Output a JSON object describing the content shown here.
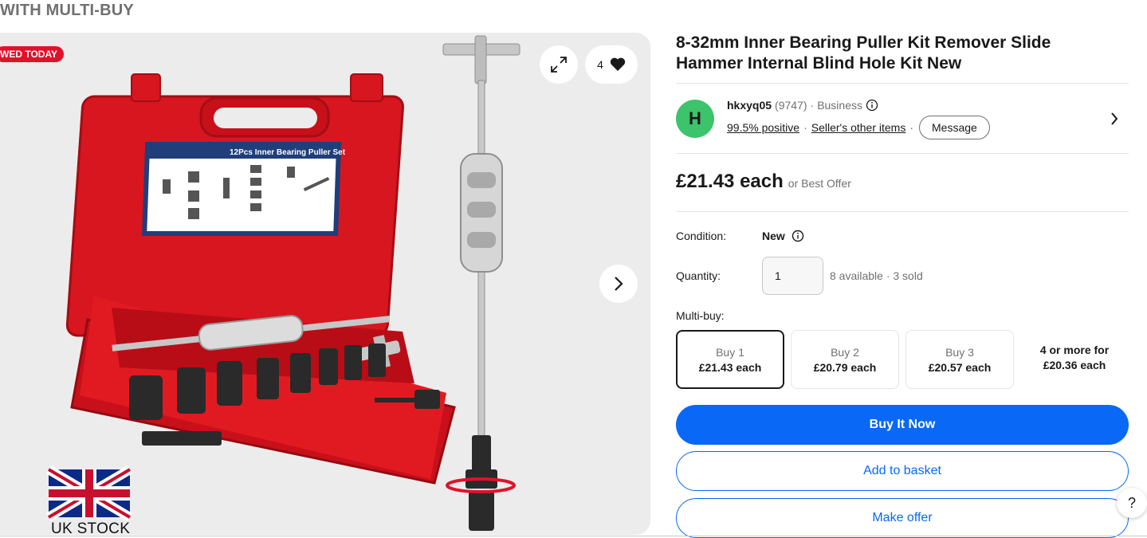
{
  "promo": {
    "text": "WITH MULTI-BUY"
  },
  "gallery": {
    "badge": "WED TODAY",
    "image_count": "4",
    "expand_icon": "expand-icon",
    "heart_icon": "heart-icon",
    "next_icon": "chevron-right-icon",
    "box_label": "12Pcs Inner Bearing Puller Set",
    "uk_stock": "UK STOCK"
  },
  "listing": {
    "title": "8-32mm Inner Bearing Puller Kit Remover Slide Hammer Internal Blind Hole Kit New",
    "seller": {
      "avatar_letter": "H",
      "name": "hkxyq05",
      "feedback_count": "(9747)",
      "separator": "·",
      "type": "Business",
      "positive": "99.5% positive",
      "other_items": "Seller's other items",
      "message": "Message"
    },
    "price": "£21.43 each",
    "price_note": "or Best Offer",
    "condition_label": "Condition:",
    "condition_value": "New",
    "quantity_label": "Quantity:",
    "quantity_value": "1",
    "availability": "8 available · 3 sold",
    "multibuy_label": "Multi-buy:",
    "multibuy": [
      {
        "label": "Buy 1",
        "price": "£21.43 each"
      },
      {
        "label": "Buy 2",
        "price": "£20.79 each"
      },
      {
        "label": "Buy 3",
        "price": "£20.57 each"
      }
    ],
    "multibuy_more_line1": "4 or more for",
    "multibuy_more_line2": "£20.36 each",
    "buy_now": "Buy It Now",
    "add_basket": "Add to basket",
    "make_offer": "Make offer"
  },
  "help": {
    "label": "?"
  },
  "colors": {
    "accent": "#0968f6",
    "badge": "#e0122a",
    "avatar": "#3dc36b",
    "case": "#d7161f"
  }
}
